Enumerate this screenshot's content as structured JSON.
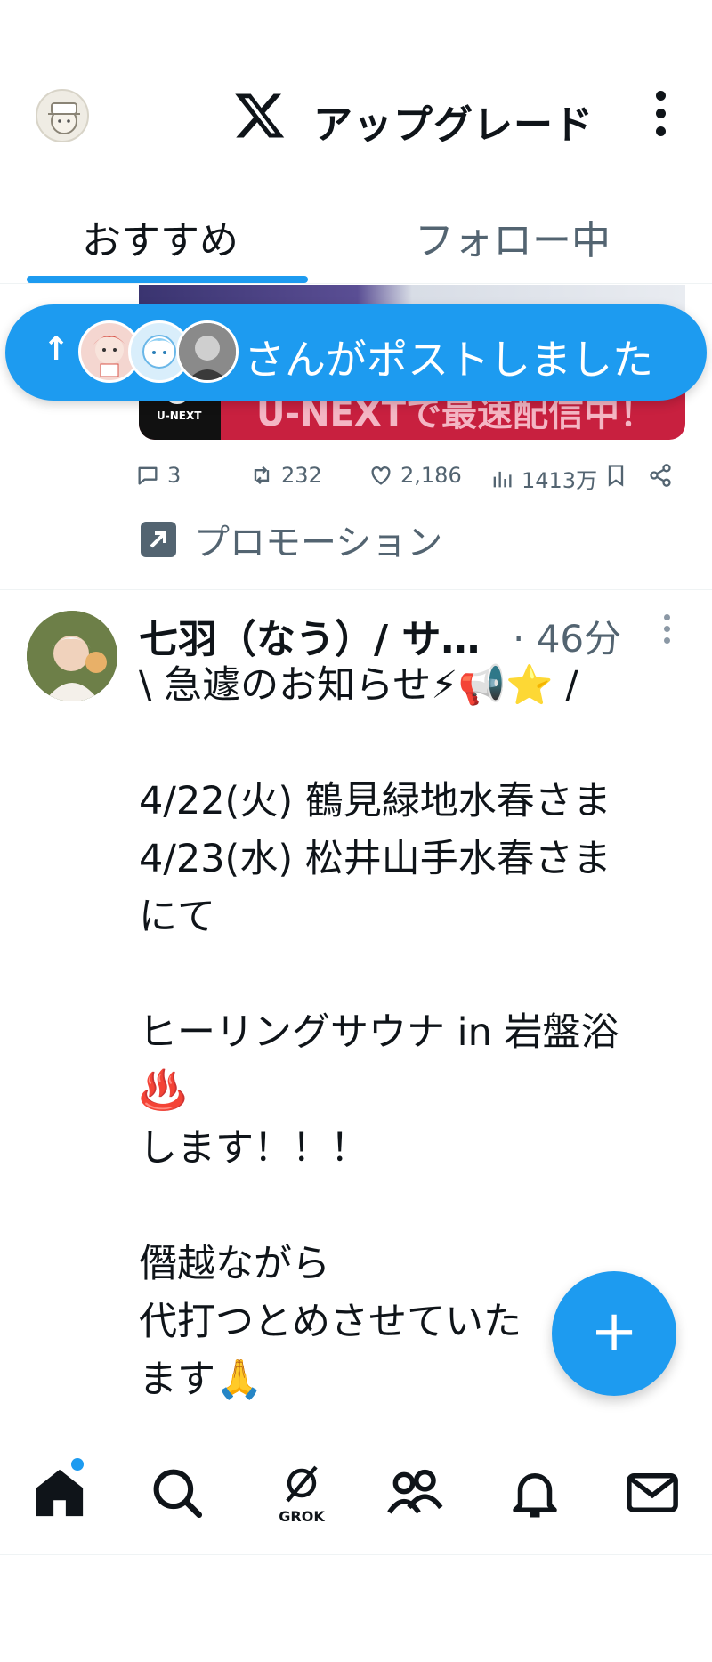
{
  "header": {
    "upgrade_label": "アップグレード",
    "tabs": [
      {
        "label": "おすすめ",
        "active": true
      },
      {
        "label": "フォロー中",
        "active": false
      }
    ]
  },
  "promo_card": {
    "brand": "U-NEXT",
    "banner_text": "U-NEXTで最速配信中！"
  },
  "new_posts_pill": {
    "text": "さんがポストしました"
  },
  "promoted_post": {
    "replies": "3",
    "reposts": "232",
    "likes": "2,186",
    "views": "1413万",
    "promotion_label": "プロモーション"
  },
  "tweet": {
    "author": "七羽（なう）/ サ…",
    "time": "· 46分",
    "lines": [
      "\\ 急遽のお知らせ⚡📢⭐ /",
      "",
      "4/22(火) 鶴見緑地水春さま",
      "4/23(水) 松井山手水春さま",
      "にて",
      "",
      "ヒーリングサウナ in 岩盤浴",
      "♨️",
      "します！！！",
      "",
      "僭越ながら",
      "代打つとめさせていた",
      "ます🙏"
    ]
  },
  "fab": {
    "label": "+"
  },
  "bottom_nav": {
    "grok_label": "GROK",
    "items": [
      "home-icon",
      "search-icon",
      "grok-icon",
      "communities-icon",
      "notifications-icon",
      "messages-icon"
    ]
  },
  "colors": {
    "accent": "#1d9bf0",
    "text": "#0f1419",
    "secondary": "#536471"
  }
}
